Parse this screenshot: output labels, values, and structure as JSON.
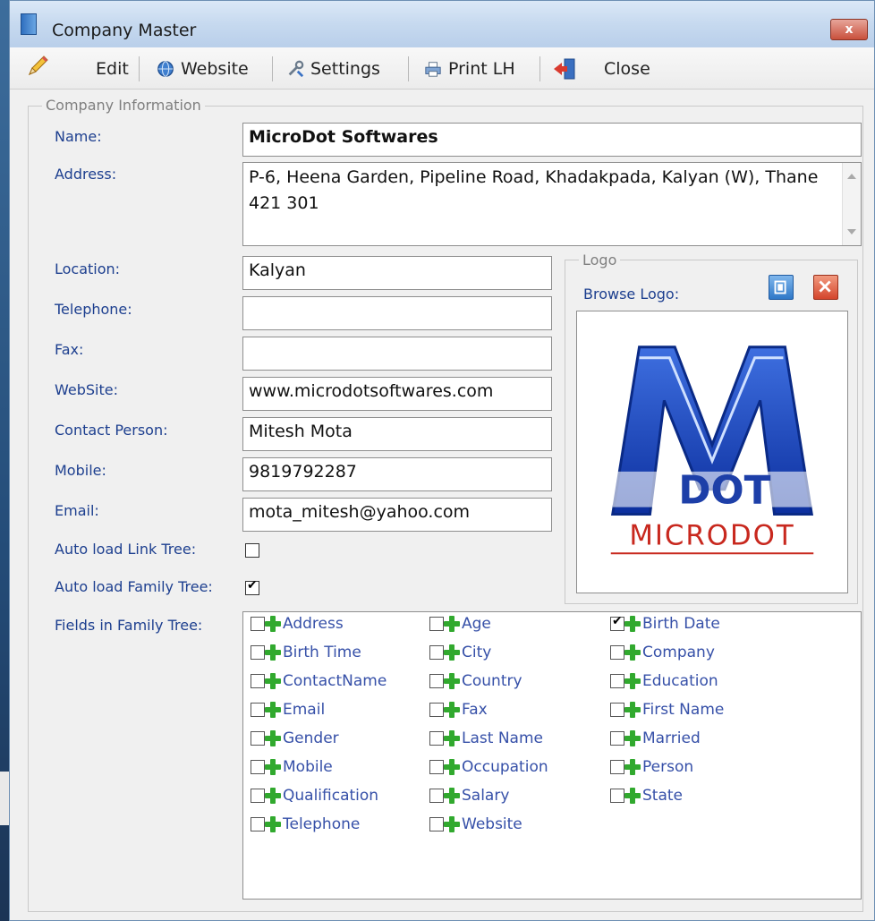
{
  "window": {
    "title": "Company Master",
    "close_glyph": "x"
  },
  "toolbar": {
    "edit": "Edit",
    "website": "Website",
    "settings": "Settings",
    "print": "Print LH",
    "close": "Close",
    "icons": [
      "pencil-icon",
      "globe-icon",
      "wrench-icon",
      "printer-icon",
      "exit-icon"
    ]
  },
  "company_info": {
    "legend": "Company Information",
    "name_label": "Name:",
    "name_value": "MicroDot Softwares",
    "address_label": "Address:",
    "address_value": "P-6, Heena Garden, Pipeline Road, Khadakpada, Kalyan (W), Thane 421 301",
    "location_label": "Location:",
    "location_value": "Kalyan",
    "telephone_label": "Telephone:",
    "telephone_value": "",
    "fax_label": "Fax:",
    "fax_value": "",
    "website_label": "WebSite:",
    "website_value": "www.microdotsoftwares.com",
    "contact_label": "Contact Person:",
    "contact_value": "Mitesh Mota",
    "mobile_label": "Mobile:",
    "mobile_value": "9819792287",
    "email_label": "Email:",
    "email_value": "mota_mitesh@yahoo.com",
    "auto_link_label": "Auto load Link Tree:",
    "auto_link_checked": false,
    "auto_family_label": "Auto load Family Tree:",
    "auto_family_checked": true,
    "fields_label": "Fields in Family Tree:"
  },
  "logo": {
    "legend": "Logo",
    "browse_label": "Browse Logo:",
    "logo_letters": "DOT",
    "logo_wordmark": "MICRODOT"
  },
  "family_fields": [
    {
      "label": "Address",
      "checked": false
    },
    {
      "label": "Age",
      "checked": false
    },
    {
      "label": "Birth Date",
      "checked": true
    },
    {
      "label": "Birth Time",
      "checked": false
    },
    {
      "label": "City",
      "checked": false
    },
    {
      "label": "Company",
      "checked": false
    },
    {
      "label": "ContactName",
      "checked": false
    },
    {
      "label": "Country",
      "checked": false
    },
    {
      "label": "Education",
      "checked": false
    },
    {
      "label": "Email",
      "checked": false
    },
    {
      "label": "Fax",
      "checked": false
    },
    {
      "label": "First Name",
      "checked": false
    },
    {
      "label": "Gender",
      "checked": false
    },
    {
      "label": "Last Name",
      "checked": false
    },
    {
      "label": "Married",
      "checked": false
    },
    {
      "label": "Mobile",
      "checked": false
    },
    {
      "label": "Occupation",
      "checked": false
    },
    {
      "label": "Person",
      "checked": false
    },
    {
      "label": "Qualification",
      "checked": false
    },
    {
      "label": "Salary",
      "checked": false
    },
    {
      "label": "State",
      "checked": false
    },
    {
      "label": "Telephone",
      "checked": false
    },
    {
      "label": "Website",
      "checked": false
    }
  ]
}
